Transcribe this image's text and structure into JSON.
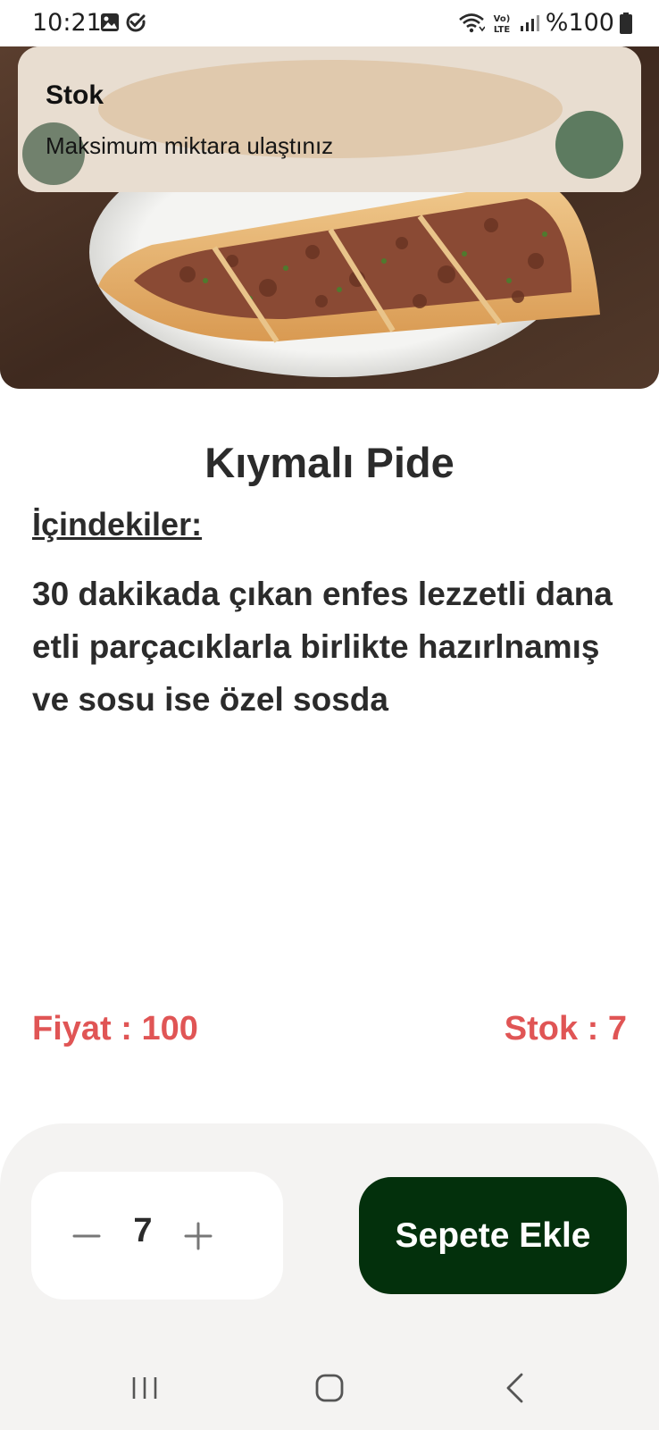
{
  "status_bar": {
    "time": "10:21",
    "battery": "%100",
    "icons": [
      "gallery-icon",
      "check-circle-icon",
      "wifi-icon",
      "volte-icon",
      "signal-icon",
      "battery-icon"
    ]
  },
  "toast": {
    "title": "Stok",
    "message": "Maksimum miktara ulaştınız"
  },
  "product": {
    "name": "Kıymalı Pide",
    "ingredients_label": "İçindekiler:",
    "description": "30 dakikada çıkan enfes lezzetli dana etli parçacıklarla birlikte hazırlnamış ve sosu ise özel sosda",
    "price_text": "Fiyat : 100",
    "stock_text": "Stok : 7"
  },
  "cart": {
    "quantity": "7",
    "add_button_label": "Sepete Ekle"
  },
  "colors": {
    "accent_red": "#e05555",
    "button_green": "#03300c",
    "panel_bg": "#f4f3f2"
  }
}
